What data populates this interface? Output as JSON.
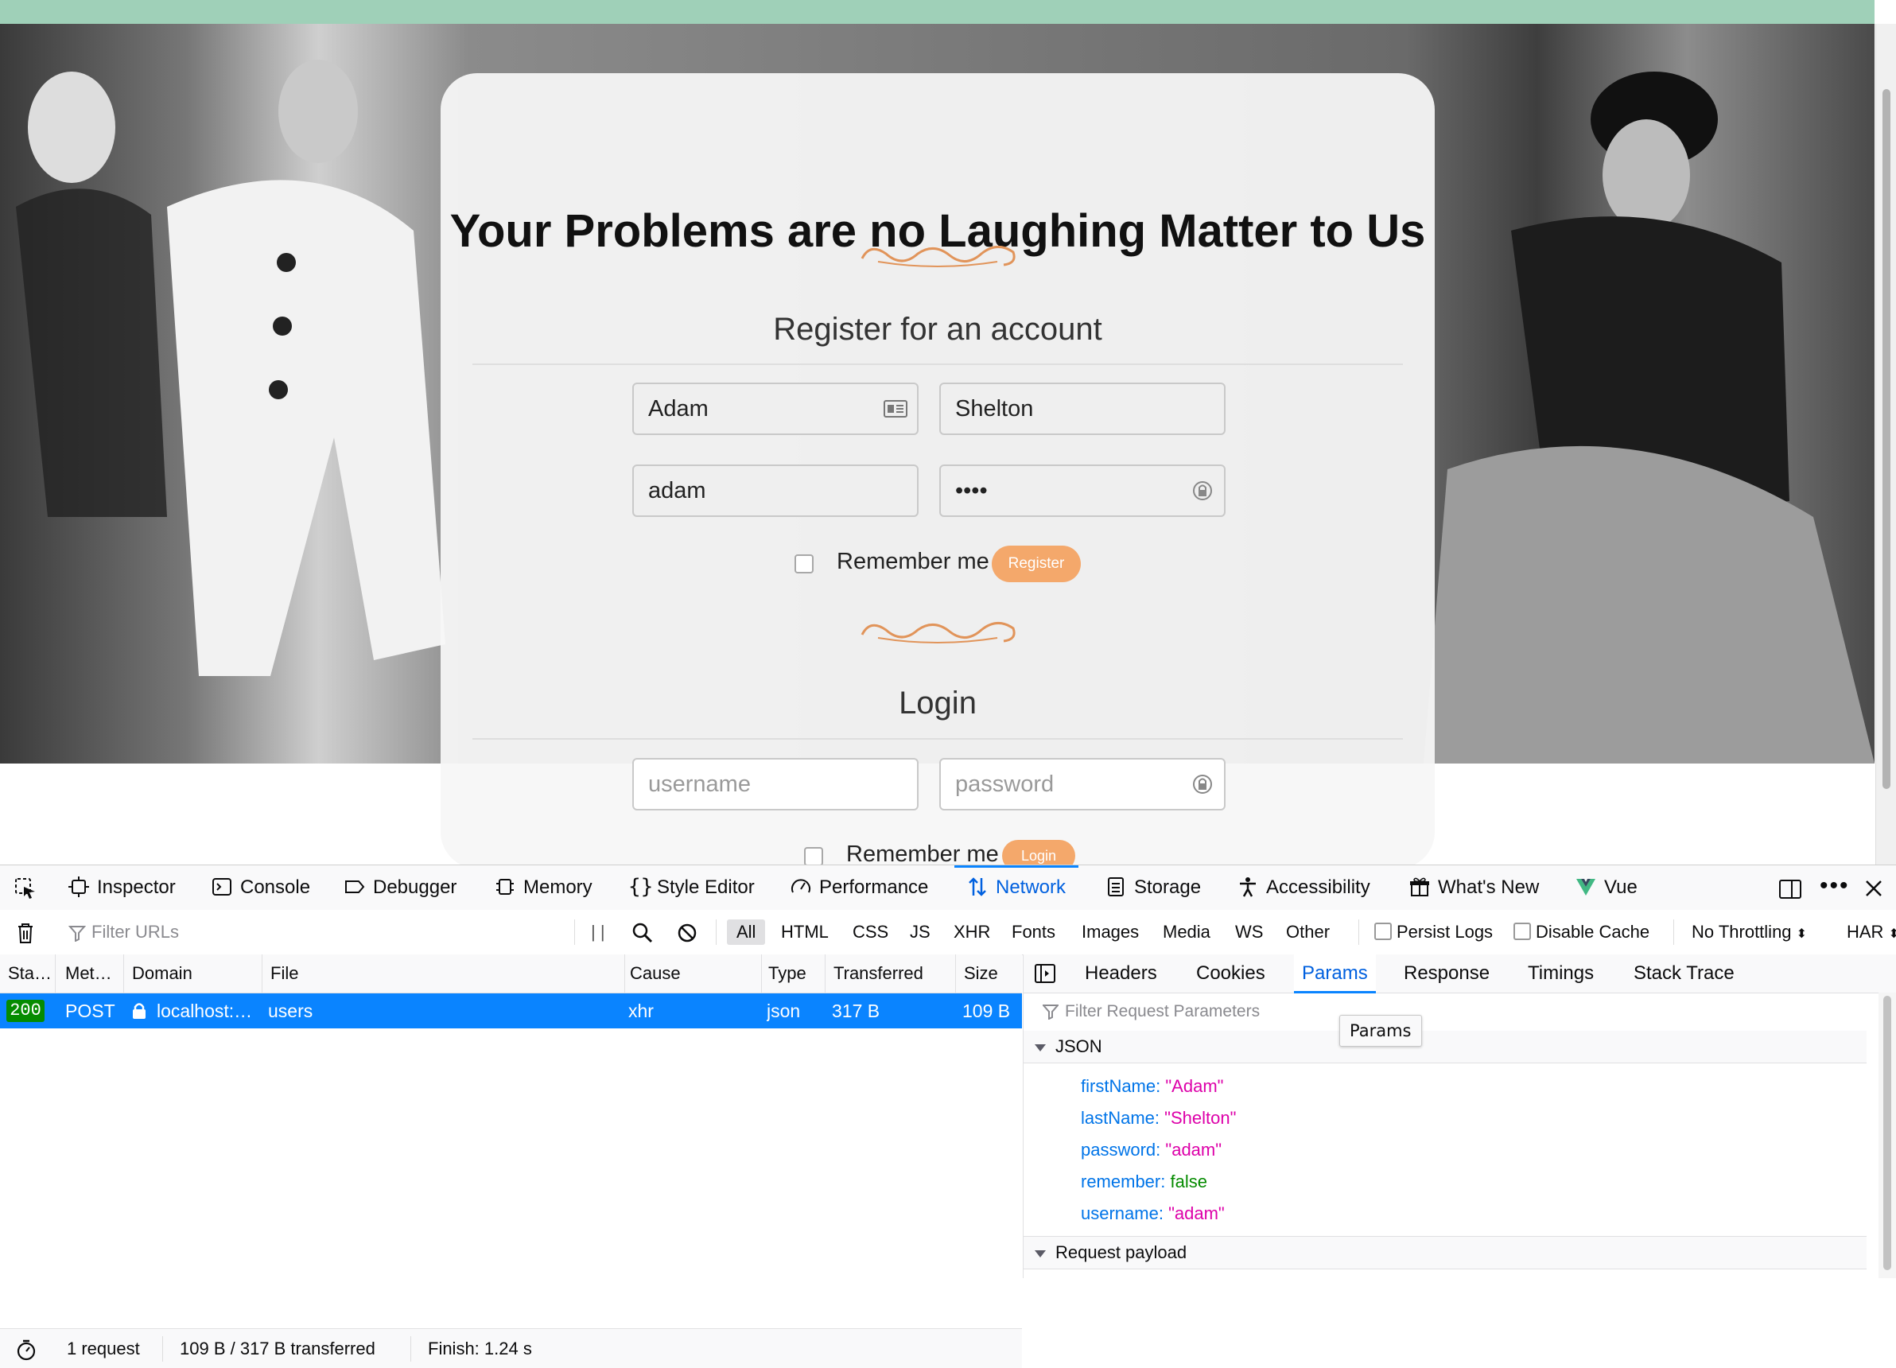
{
  "page": {
    "heading": "Your Problems are no Laughing Matter to Us",
    "register": {
      "title": "Register for an account",
      "first_name": "Adam",
      "last_name": "Shelton",
      "username": "adam",
      "password_mask": "••••",
      "remember_label": "Remember me",
      "button": "Register"
    },
    "login": {
      "title": "Login",
      "username_placeholder": "username",
      "password_placeholder": "password",
      "remember_label": "Remember me",
      "button": "Login"
    },
    "accent_color": "#f4a86b",
    "topbar_color": "#9fd0b8"
  },
  "devtools": {
    "tabs": [
      {
        "label": "Inspector",
        "icon": "inspector-icon"
      },
      {
        "label": "Console",
        "icon": "console-icon"
      },
      {
        "label": "Debugger",
        "icon": "debugger-icon"
      },
      {
        "label": "Memory",
        "icon": "memory-icon"
      },
      {
        "label": "Style Editor",
        "icon": "braces-icon"
      },
      {
        "label": "Performance",
        "icon": "gauge-icon"
      },
      {
        "label": "Network",
        "icon": "network-arrows-icon",
        "active": true
      },
      {
        "label": "Storage",
        "icon": "storage-icon"
      },
      {
        "label": "Accessibility",
        "icon": "accessibility-icon"
      },
      {
        "label": "What's New",
        "icon": "gift-icon"
      },
      {
        "label": "Vue",
        "icon": "vue-logo-icon"
      }
    ],
    "toolbar": {
      "filter_placeholder": "Filter URLs",
      "types": [
        "All",
        "HTML",
        "CSS",
        "JS",
        "XHR",
        "Fonts",
        "Images",
        "Media",
        "WS",
        "Other"
      ],
      "active_type": "All",
      "persist_logs": "Persist Logs",
      "disable_cache": "Disable Cache",
      "throttling": "No Throttling",
      "har": "HAR"
    },
    "columns": [
      "Sta…",
      "Met…",
      "Domain",
      "File",
      "Cause",
      "Type",
      "Transferred",
      "Size"
    ],
    "request": {
      "status": "200",
      "method": "POST",
      "domain": "localhost:…",
      "file": "users",
      "cause": "xhr",
      "type": "json",
      "transferred": "317 B",
      "size": "109 B"
    },
    "status_bar": {
      "requests": "1 request",
      "transferred": "109 B / 317 B transferred",
      "finish": "Finish: 1.24 s"
    },
    "side_tabs": [
      "Headers",
      "Cookies",
      "Params",
      "Response",
      "Timings",
      "Stack Trace"
    ],
    "active_side_tab": "Params",
    "params_filter_placeholder": "Filter Request Parameters",
    "json_group": "JSON",
    "params": [
      {
        "key": "firstName:",
        "value": "\"Adam\"",
        "kind": "str"
      },
      {
        "key": "lastName:",
        "value": "\"Shelton\"",
        "kind": "str"
      },
      {
        "key": "password:",
        "value": "\"adam\"",
        "kind": "str"
      },
      {
        "key": "remember:",
        "value": "false",
        "kind": "bool"
      },
      {
        "key": "username:",
        "value": "\"adam\"",
        "kind": "str"
      }
    ],
    "payload_group": "Request payload",
    "tooltip": "Params"
  }
}
